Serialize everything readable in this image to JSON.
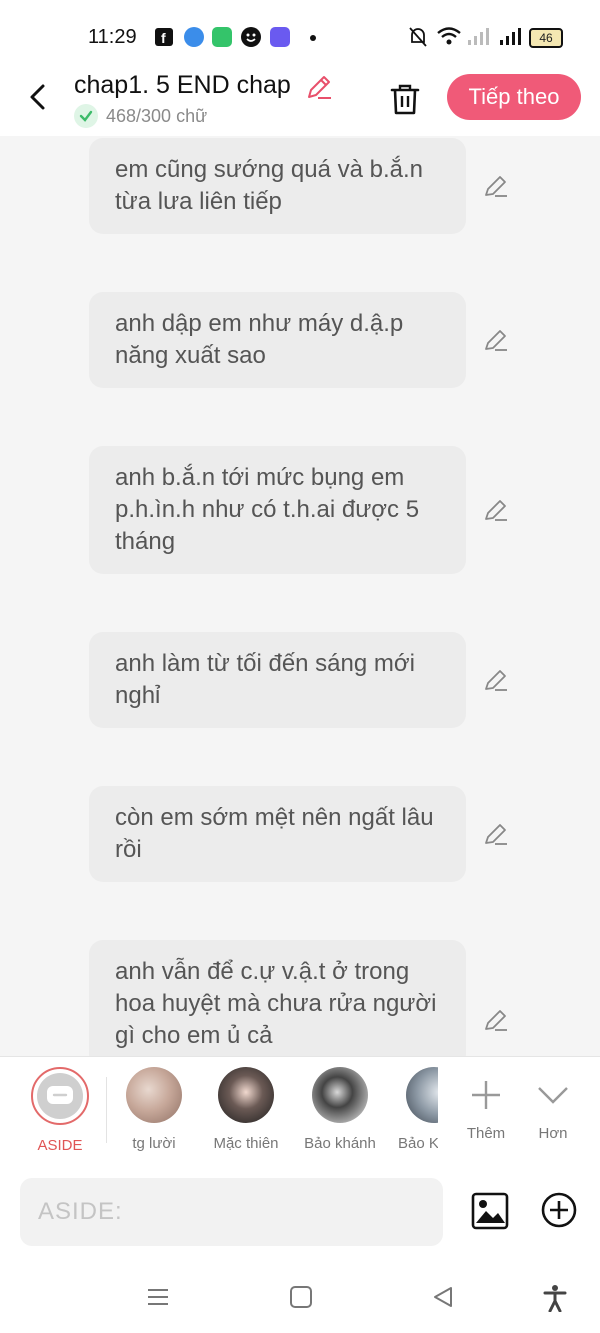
{
  "status": {
    "time": "11:29",
    "battery": "46"
  },
  "header": {
    "title": "chap1. 5 END chap",
    "word_count": "468/300 chữ",
    "next_label": "Tiếp theo"
  },
  "messages": [
    {
      "text": "em cũng sướng quá và b.ắ.n từa lưa liên tiếp"
    },
    {
      "text": "anh dập em như máy d.ậ.p năng xuất sao"
    },
    {
      "text": "anh b.ắ.n tới mức bụng em p.h.ìn.h như có t.h.ai được 5 tháng"
    },
    {
      "text": "anh làm từ tối đến sáng mới nghỉ"
    },
    {
      "text": "còn em sớm mệt nên ngất lâu rồi"
    },
    {
      "text": "anh vẫn để c.ự v.ậ.t ở trong hoa huyệt mà chưa rửa người gì cho em ủ cả"
    }
  ],
  "characters": {
    "aside_label": "ASIDE",
    "items": [
      {
        "name": "tg lười"
      },
      {
        "name": "Mặc thiên"
      },
      {
        "name": "Bảo khánh"
      },
      {
        "name": "Bảo Khải"
      }
    ],
    "more_label": "Thêm",
    "collapse_label": "Hơn"
  },
  "input": {
    "placeholder": "ASIDE:"
  },
  "colors": {
    "accent": "#f05a78",
    "bubble": "#ececec",
    "check": "#3dbb6a"
  }
}
